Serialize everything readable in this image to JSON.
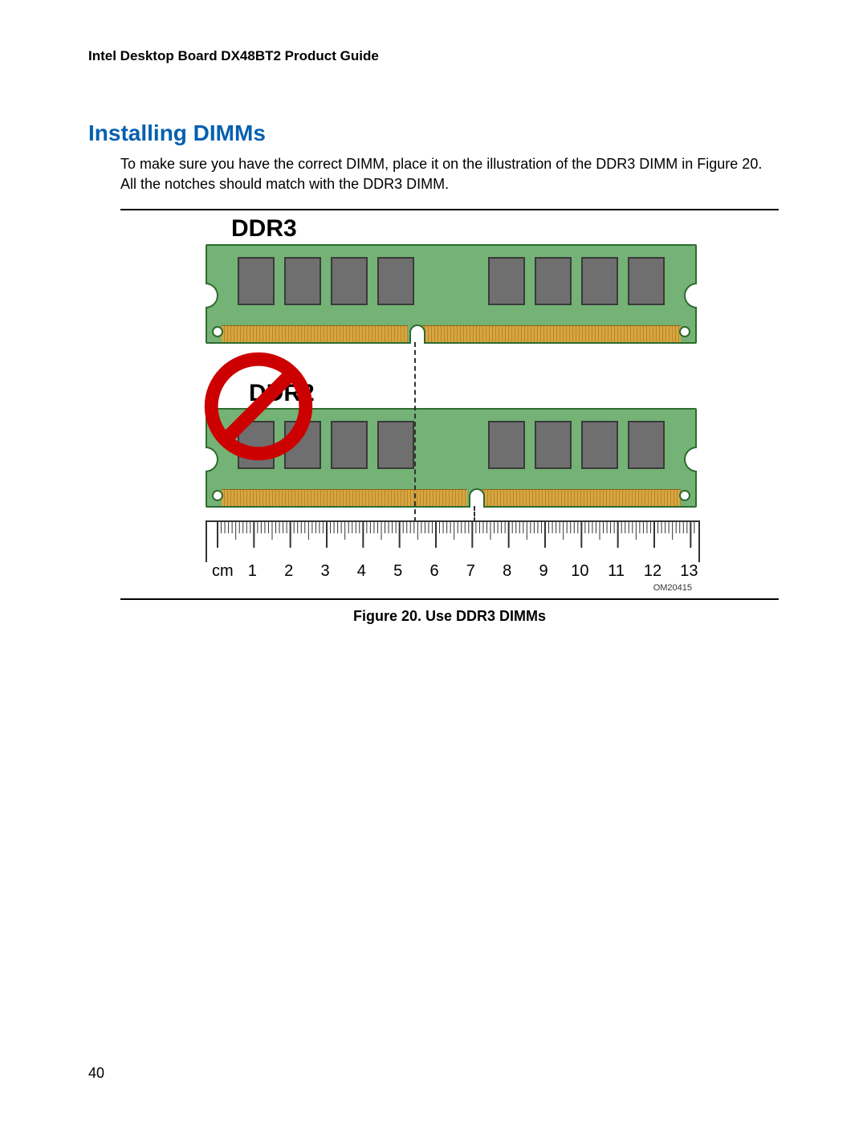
{
  "header": "Intel Desktop Board DX48BT2 Product Guide",
  "page_number": "40",
  "section_title": "Installing DIMMs",
  "body_text": "To make sure you have the correct DIMM, place it on the illustration of the DDR3 DIMM in Figure 20.  All the notches should match with the DDR3 DIMM.",
  "figure": {
    "caption": "Figure 20.  Use DDR3 DIMMs",
    "labels": {
      "top": "DDR3",
      "bottom": "DDR2"
    },
    "om_code": "OM20415",
    "ruler_unit": "cm",
    "ruler_numbers": [
      "1",
      "2",
      "3",
      "4",
      "5",
      "6",
      "7",
      "8",
      "9",
      "10",
      "11",
      "12",
      "13"
    ],
    "notch_cm": {
      "ddr3": 5.5,
      "ddr2": 7.1
    },
    "colors": {
      "pcb": "#74b276",
      "pcb_border": "#2e6b30",
      "chip": "#6f6f6f",
      "contact": "#d8a640",
      "prohibit": "#cc0000",
      "title": "#0560b0"
    }
  }
}
